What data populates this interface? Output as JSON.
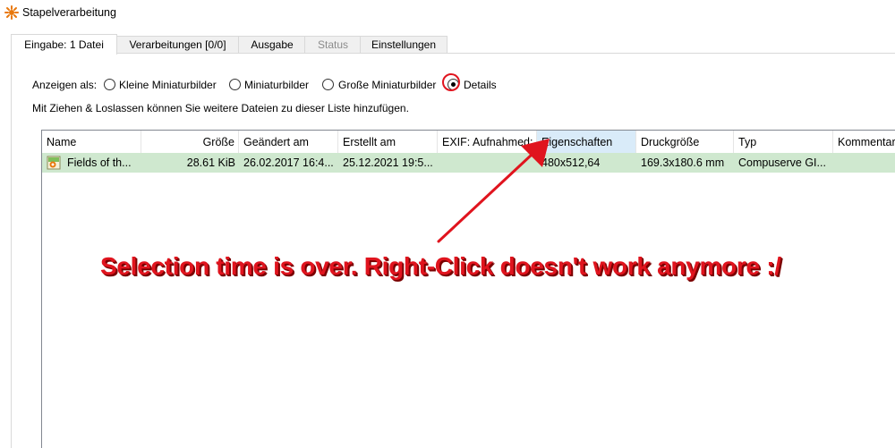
{
  "window": {
    "title": "Stapelverarbeitung"
  },
  "tabs": [
    {
      "label": "Eingabe: 1 Datei"
    },
    {
      "label": "Verarbeitungen [0/0]"
    },
    {
      "label": "Ausgabe"
    },
    {
      "label": "Status"
    },
    {
      "label": "Einstellungen"
    }
  ],
  "view": {
    "label": "Anzeigen als:",
    "options": [
      {
        "label": "Kleine Miniaturbilder",
        "checked": false
      },
      {
        "label": "Miniaturbilder",
        "checked": false
      },
      {
        "label": "Große Miniaturbilder",
        "checked": false
      },
      {
        "label": "Details",
        "checked": true
      }
    ]
  },
  "hint": "Mit Ziehen & Loslassen können Sie weitere Dateien zu dieser Liste hinzufügen.",
  "list": {
    "columns": [
      "Name",
      "Größe",
      "Geändert am",
      "Erstellt am",
      "EXIF: Aufnahmed:",
      "Eigenschaften",
      "Druckgröße",
      "Typ",
      "Kommentar"
    ],
    "rows": [
      {
        "name": "Fields of th...",
        "size": "28.61 KiB",
        "modified": "26.02.2017 16:4...",
        "created": "25.12.2021 19:5...",
        "exif": "",
        "properties": "480x512,64",
        "print_size": "169.3x180.6 mm",
        "type": "Compuserve GI...",
        "comment": ""
      }
    ]
  },
  "annotation": {
    "text": "Selection time is over. Right-Click doesn't work anymore :/",
    "color": "#e0141e"
  },
  "colors": {
    "selected_row": "#cfe8cf",
    "sorted_header": "#d9ebf9",
    "annotation_red": "#e0141e"
  }
}
